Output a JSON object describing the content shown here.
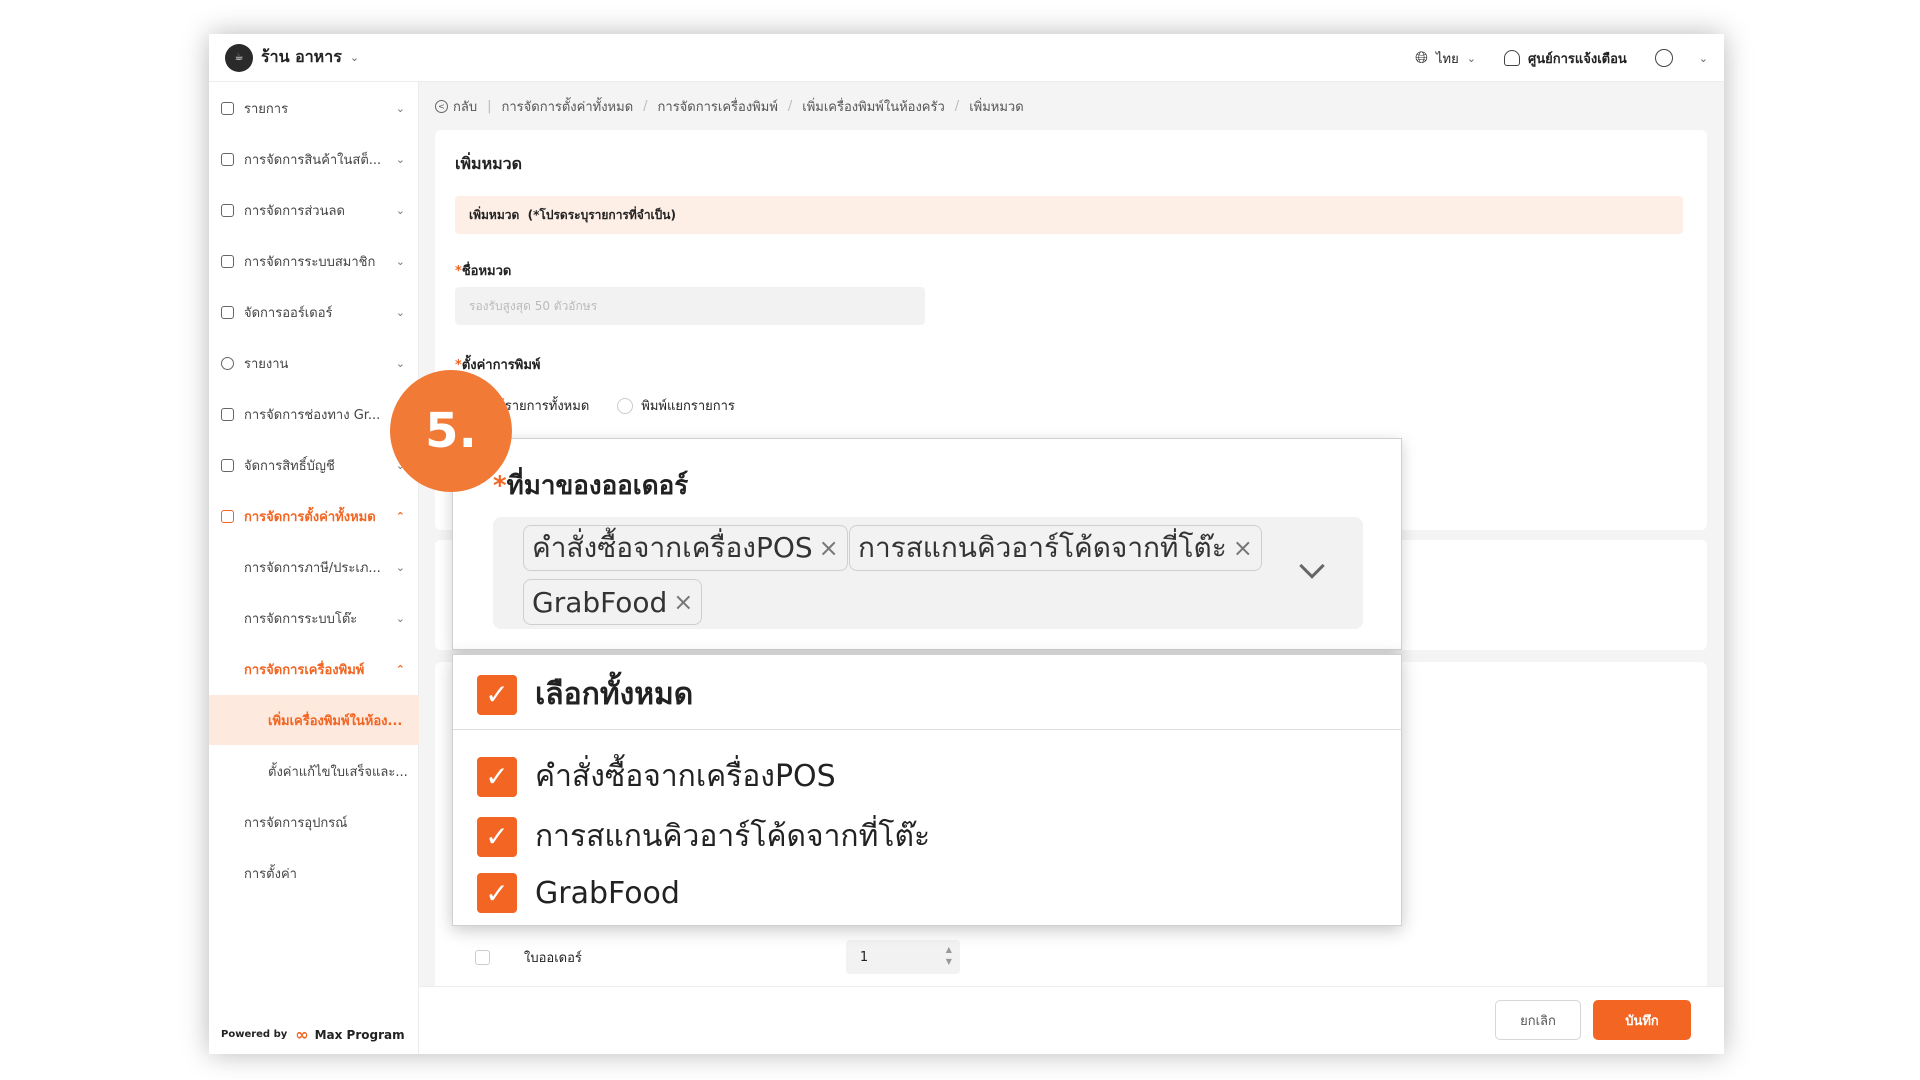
{
  "header": {
    "store_name": "ร้าน อาหาร",
    "language": "ไทย",
    "notifications": "ศูนย์การแจ้งเตือน"
  },
  "sidebar": {
    "items": [
      {
        "label": "รายการ",
        "arrow": "⌄"
      },
      {
        "label": "การจัดการสินค้าในสต็...",
        "arrow": "⌄"
      },
      {
        "label": "การจัดการส่วนลด",
        "arrow": "⌄"
      },
      {
        "label": "การจัดการระบบสมาชิก",
        "arrow": "⌄"
      },
      {
        "label": "จัดการออร์เดอร์",
        "arrow": "⌄"
      },
      {
        "label": "รายงาน",
        "arrow": "⌄"
      },
      {
        "label": "การจัดการช่องทาง Gr...",
        "arrow": "⌄"
      },
      {
        "label": "จัดการสิทธิ์บัญชี",
        "arrow": "⌄"
      },
      {
        "label": "การจัดการตั้งค่าทั้งหมด",
        "arrow": "⌃"
      },
      {
        "label": "การจัดการภาษี/ประเภ...",
        "arrow": "⌄"
      },
      {
        "label": "การจัดการระบบโต๊ะ",
        "arrow": "⌄"
      },
      {
        "label": "การจัดการเครื่องพิมพ์",
        "arrow": "⌃"
      },
      {
        "label": "เพิ่มเครื่องพิมพ์ในห้อง..."
      },
      {
        "label": "ตั้งค่าแก้ไขใบเสร็จและ..."
      },
      {
        "label": "การจัดการอุปกรณ์"
      },
      {
        "label": "การตั้งค่า"
      }
    ],
    "powered_by": "Powered by",
    "brand": "Max Program"
  },
  "breadcrumb": {
    "back": "กลับ",
    "items": [
      "การจัดการตั้งค่าทั้งหมด",
      "การจัดการเครื่องพิมพ์",
      "เพิ่มเครื่องพิมพ์ในห้องครัว",
      "เพิ่มหมวด"
    ]
  },
  "form": {
    "title": "เพิ่มหมวด",
    "notice_title": "เพิ่มหมวด",
    "notice_note": "(*โปรดระบุรายการที่จำเป็น)",
    "name_label": "ชื่อหมวด",
    "name_placeholder": "รองรับสูงสุด 50 ตัวอักษร",
    "print_label": "ตั้งค่าการพิมพ์",
    "print_option_all": "พิมพ์รายการทั้งหมด",
    "print_option_separate": "พิมพ์แยกรายการ",
    "bottom_row_label": "ใบออเดอร์",
    "bottom_row_value": "1"
  },
  "footer": {
    "cancel": "ยกเลิก",
    "save": "บันทึก"
  },
  "callout": {
    "step": "5.",
    "field_label": "ที่มาของออเดอร์",
    "tags": [
      "คำสั่งซื้อจากเครื่องPOS",
      "การสแกนคิวอาร์โค้ดจากที่โต๊ะ",
      "GrabFood"
    ],
    "dropdown": {
      "select_all": "เลือกทั้งหมด",
      "options": [
        "คำสั่งซื้อจากเครื่องPOS",
        "การสแกนคิวอาร์โค้ดจากที่โต๊ะ",
        "GrabFood"
      ]
    }
  },
  "colors": {
    "accent": "#f26522",
    "notice_bg": "#fdeee6",
    "step_badge": "#f07a36"
  }
}
